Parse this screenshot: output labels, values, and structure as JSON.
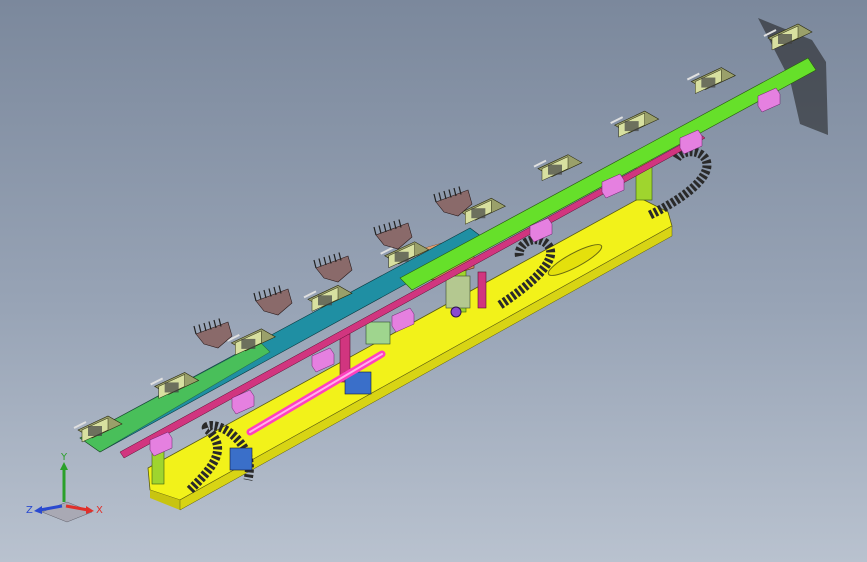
{
  "viewport": {
    "background_top": "#7b889c",
    "background_bottom": "#b9c2cf"
  },
  "model": {
    "colors": {
      "base_plate": "#f2f21a",
      "belt_green": "#66e02a",
      "belt_teal": "#1f8fa3",
      "rail": "#d1357f",
      "clamp": "#8a6a6a",
      "gripper_plate": "#9aa06a",
      "bracket": "#e580e0",
      "post": "#8fcf2a",
      "block": "#d08a5a",
      "rod": "#ff40c0",
      "chain": "#2a2a2a",
      "motor": "#3a6fc9",
      "shadow": "#1c1c1c"
    },
    "gripper_count": 10,
    "claw_count": 5
  },
  "triad": {
    "x_label": "X",
    "y_label": "Y",
    "z_label": "Z",
    "x_color": "#e0302a",
    "y_color": "#2aa02a",
    "z_color": "#2a4ad0"
  }
}
